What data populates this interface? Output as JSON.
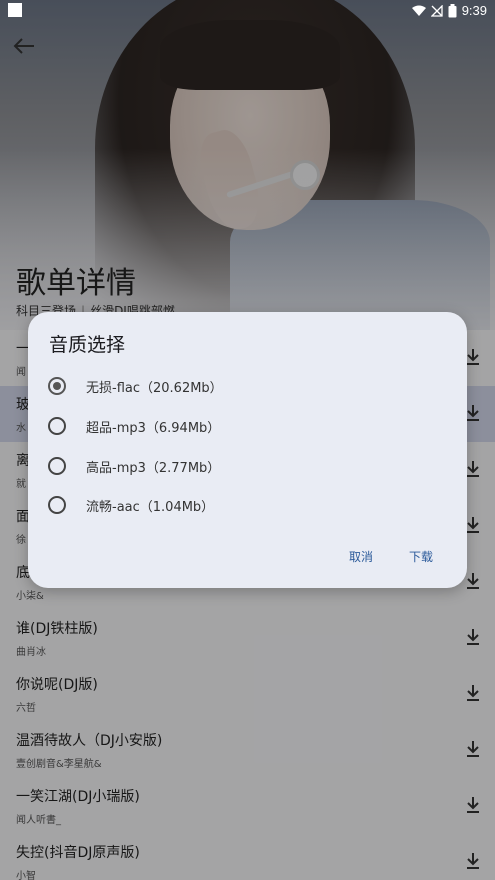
{
  "status": {
    "time": "9:39"
  },
  "header": {
    "title": "歌单详情",
    "subtitle_left": "科目三登场",
    "subtitle_right": "丝滑DJ唱跳部燃"
  },
  "songs": [
    {
      "name": "一",
      "artist": "闻"
    },
    {
      "name": "玻",
      "artist": "水"
    },
    {
      "name": "离",
      "artist": "就"
    },
    {
      "name": "面",
      "artist": "徐"
    },
    {
      "name": "底",
      "artist": "小柒&"
    },
    {
      "name": "谁(DJ铁柱版)",
      "artist": "曲肖冰"
    },
    {
      "name": "你说呢(DJ版)",
      "artist": "六哲"
    },
    {
      "name": "温酒待故人（DJ小安版)",
      "artist": "壹创剧音&李星航&"
    },
    {
      "name": "一笑江湖(DJ小瑞版)",
      "artist": "闻人听書_"
    },
    {
      "name": "失控(抖音DJ原声版)",
      "artist": "小智"
    }
  ],
  "dialog": {
    "title": "音质选择",
    "options": [
      {
        "label": "无损-flac（20.62Mb）",
        "selected": true
      },
      {
        "label": "超品-mp3（6.94Mb）",
        "selected": false
      },
      {
        "label": "高品-mp3（2.77Mb）",
        "selected": false
      },
      {
        "label": "流畅-aac（1.04Mb）",
        "selected": false
      }
    ],
    "cancel": "取消",
    "confirm": "下载"
  },
  "colors": {
    "accent": "#2b5a9a",
    "highlight_row": "#cfd3e6",
    "dialog_bg": "#e9ecf4"
  }
}
